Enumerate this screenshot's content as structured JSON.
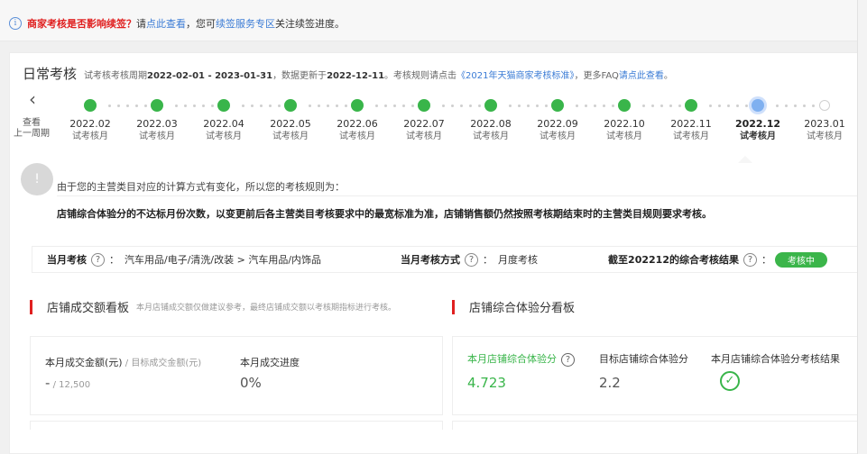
{
  "notice": {
    "lead": "商家考核是否影响续签？",
    "text1": "请",
    "link1": "点此查看",
    "text2": "，您可",
    "link2": "续签服务专区",
    "text3": "关注续签进度。"
  },
  "header": {
    "title": "日常考核",
    "period_label": "试考核考核周期",
    "period": "2022-02-01 - 2023-01-31",
    "update_label": "，数据更新于",
    "update_date": "2022-12-11",
    "rule_text": "。考核规则请点击",
    "rule_link": "《2021年天猫商家考核标准》",
    "faq_text": "，更多FAQ",
    "faq_link": "请点此查看",
    "end": "。"
  },
  "back": {
    "icon": "chevron-left-icon",
    "label_line1": "查看",
    "label_line2": "上一周期"
  },
  "timeline": [
    {
      "month": "2022.02",
      "sub": "试考核月",
      "state": "done"
    },
    {
      "month": "2022.03",
      "sub": "试考核月",
      "state": "done"
    },
    {
      "month": "2022.04",
      "sub": "试考核月",
      "state": "done"
    },
    {
      "month": "2022.05",
      "sub": "试考核月",
      "state": "done"
    },
    {
      "month": "2022.06",
      "sub": "试考核月",
      "state": "done"
    },
    {
      "month": "2022.07",
      "sub": "试考核月",
      "state": "done"
    },
    {
      "month": "2022.08",
      "sub": "试考核月",
      "state": "done"
    },
    {
      "month": "2022.09",
      "sub": "试考核月",
      "state": "done"
    },
    {
      "month": "2022.10",
      "sub": "试考核月",
      "state": "done"
    },
    {
      "month": "2022.11",
      "sub": "试考核月",
      "state": "done"
    },
    {
      "month": "2022.12",
      "sub": "试考核月",
      "state": "current"
    },
    {
      "month": "2023.01",
      "sub": "试考核月",
      "state": "future"
    }
  ],
  "rule_notice": {
    "line1": "由于您的主营类目对应的计算方式有变化，所以您的考核规则为：",
    "line2": "店铺综合体验分的不达标月份次数，以变更前后各主营类目考核要求中的最宽标准为准，店铺销售额仍然按照考核期结束时的主营类目规则要求考核。"
  },
  "month_bar": {
    "current_label": "当月考核",
    "category": "汽车用品/电子/清洗/改装 > 汽车用品/内饰品",
    "method_label": "当月考核方式",
    "method_value": "月度考核",
    "result_label": "截至202212的综合考核结果",
    "result_badge": "考核中",
    "colon": "："
  },
  "sales_board": {
    "title": "店铺成交额看板",
    "note": "本月店铺成交额仅做建议参考，最终店铺成交额以考核期指标进行考核。",
    "amount_label": "本月成交金额(元)",
    "target_label": " / 目标成交金额(元)",
    "amount_value": "-",
    "target_value": "12,500",
    "progress_label": "本月成交进度",
    "progress_value": "0%"
  },
  "score_board": {
    "title": "店铺综合体验分看板",
    "score_label": "本月店铺综合体验分",
    "score_value": "4.723",
    "target_label": "目标店铺综合体验分",
    "target_value": "2.2",
    "result_label": "本月店铺综合体验分考核结果",
    "result_icon": "check-circle-icon"
  },
  "colors": {
    "green": "#39b54a",
    "red": "#e02020",
    "blue": "#3a7bd5",
    "current": "#7fb0f0"
  }
}
